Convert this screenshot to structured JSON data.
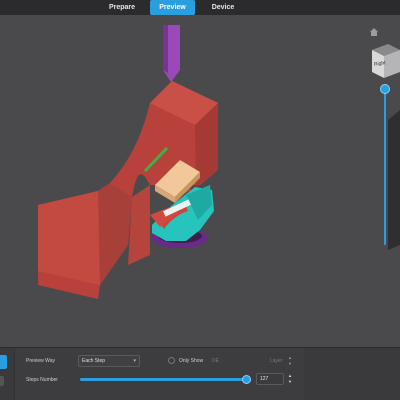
{
  "tabs": [
    {
      "label": "Prepare",
      "active": false
    },
    {
      "label": "Preview",
      "active": true
    },
    {
      "label": "Device",
      "active": false
    }
  ],
  "navigation_cube": {
    "face_label": "Right"
  },
  "layer_slider": {
    "fraction": 1.0
  },
  "controls": {
    "preview_way_label": "Preview Way",
    "preview_way_value": "Each Step",
    "only_show_label": "Only Show",
    "only_show_value": "DE",
    "layer_label": "Layer",
    "steps_number_label": "Steps Number",
    "steps_value": "127",
    "steps_fraction": 1.0
  },
  "icons": {
    "home": "home-icon",
    "chevron": "chevron-down-icon",
    "up": "chevron-up-icon",
    "down": "chevron-down-icon"
  },
  "colors": {
    "accent": "#2a9fe0",
    "background": "#4a4a4c",
    "topbar": "#2b2b2d",
    "support_structure": "#c8463d",
    "model": "#27c4bd",
    "nozzle": "#9a4ab8"
  }
}
